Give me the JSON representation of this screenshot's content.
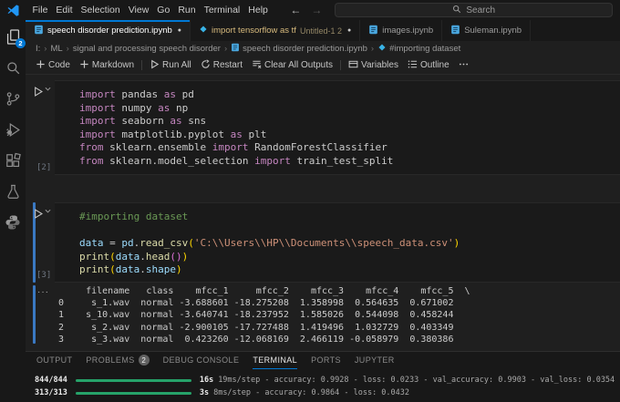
{
  "titlebar": {
    "menus": [
      "File",
      "Edit",
      "Selection",
      "View",
      "Go",
      "Run",
      "Terminal",
      "Help"
    ],
    "search_placeholder": "Search"
  },
  "activity_bar": {
    "items": [
      {
        "name": "explorer",
        "badge": "2"
      },
      {
        "name": "search"
      },
      {
        "name": "source-control"
      },
      {
        "name": "run-debug"
      },
      {
        "name": "extensions"
      },
      {
        "name": "testing"
      },
      {
        "name": "python"
      }
    ]
  },
  "tabs": [
    {
      "label": "speech disorder prediction.ipynb",
      "icon": "notebook",
      "modified": true,
      "active": true
    },
    {
      "label": "import tensorflow as tf",
      "description": "Untitled-1 2",
      "icon": "diamond",
      "modified": true,
      "active": false,
      "highlight": true
    },
    {
      "label": "images.ipynb",
      "icon": "notebook",
      "modified": false,
      "active": false
    },
    {
      "label": "Suleman.ipynb",
      "icon": "notebook",
      "modified": false,
      "active": false
    }
  ],
  "breadcrumb": {
    "items": [
      {
        "label": "I:"
      },
      {
        "label": "ML"
      },
      {
        "label": "signal and processing speech disorder"
      },
      {
        "label": "speech disorder prediction.ipynb",
        "icon": "notebook"
      },
      {
        "label": "#importing dataset",
        "icon": "diamond"
      }
    ]
  },
  "notebook_toolbar": {
    "items": [
      {
        "type": "btn",
        "icon": "add",
        "label": "Code"
      },
      {
        "type": "btn",
        "icon": "add",
        "label": "Markdown"
      },
      {
        "type": "sep"
      },
      {
        "type": "btn",
        "icon": "run",
        "label": "Run All"
      },
      {
        "type": "btn",
        "icon": "restart",
        "label": "Restart"
      },
      {
        "type": "btn",
        "icon": "clear",
        "label": "Clear All Outputs"
      },
      {
        "type": "sep"
      },
      {
        "type": "btn",
        "icon": "variables",
        "label": "Variables"
      },
      {
        "type": "btn",
        "icon": "outline",
        "label": "Outline"
      },
      {
        "type": "btn",
        "icon": "more",
        "label": ""
      }
    ]
  },
  "cells": [
    {
      "execution_count": "[2]",
      "lines": [
        [
          [
            "kw",
            "import"
          ],
          [
            "pl",
            " pandas "
          ],
          [
            "kw",
            "as"
          ],
          [
            "pl",
            " pd"
          ]
        ],
        [
          [
            "kw",
            "import"
          ],
          [
            "pl",
            " numpy "
          ],
          [
            "kw",
            "as"
          ],
          [
            "pl",
            " np"
          ]
        ],
        [
          [
            "kw",
            "import"
          ],
          [
            "pl",
            " seaborn "
          ],
          [
            "kw",
            "as"
          ],
          [
            "pl",
            " sns"
          ]
        ],
        [
          [
            "kw",
            "import"
          ],
          [
            "pl",
            " matplotlib.pyplot "
          ],
          [
            "kw",
            "as"
          ],
          [
            "pl",
            " plt"
          ]
        ],
        [
          [
            "kw",
            "from"
          ],
          [
            "pl",
            " sklearn.ensemble "
          ],
          [
            "kw",
            "import"
          ],
          [
            "pl",
            " RandomForestClassifier"
          ]
        ],
        [
          [
            "kw",
            "from"
          ],
          [
            "pl",
            " sklearn.model_selection "
          ],
          [
            "kw",
            "import"
          ],
          [
            "pl",
            " train_test_split"
          ]
        ]
      ]
    },
    {
      "execution_count": "[3]",
      "lines": [
        [
          [
            "cm",
            "#importing dataset"
          ]
        ],
        [],
        [
          [
            "var",
            "data"
          ],
          [
            "pl",
            " = "
          ],
          [
            "var",
            "pd"
          ],
          [
            "pl",
            "."
          ],
          [
            "fn",
            "read_csv"
          ],
          [
            "br1",
            "("
          ],
          [
            "str",
            "'C:\\\\Users\\\\HP\\\\Documents\\\\speech_data.csv'"
          ],
          [
            "br1",
            ")"
          ]
        ],
        [
          [
            "fn",
            "print"
          ],
          [
            "br1",
            "("
          ],
          [
            "var",
            "data"
          ],
          [
            "pl",
            "."
          ],
          [
            "fn",
            "head"
          ],
          [
            "br2",
            "("
          ],
          [
            "br2",
            ")"
          ],
          [
            "br1",
            ")"
          ]
        ],
        [
          [
            "fn",
            "print"
          ],
          [
            "br1",
            "("
          ],
          [
            "var",
            "data"
          ],
          [
            "pl",
            "."
          ],
          [
            "var",
            "shape"
          ],
          [
            "br1",
            ")"
          ]
        ]
      ]
    }
  ],
  "output_table": {
    "collapse_indicator": "···",
    "columns": [
      "",
      "filename",
      "class",
      "mfcc_1",
      "mfcc_2",
      "mfcc_3",
      "mfcc_4",
      "mfcc_5"
    ],
    "rows": [
      [
        "0",
        "s_1.wav",
        "normal",
        "-3.688601",
        "-18.275208",
        "1.358998",
        "0.564635",
        "0.671002"
      ],
      [
        "1",
        "s_10.wav",
        "normal",
        "-3.640741",
        "-18.237952",
        "1.585026",
        "0.544098",
        "0.458244"
      ],
      [
        "2",
        "s_2.wav",
        "normal",
        "-2.900105",
        "-17.727488",
        "1.419496",
        "1.032729",
        "0.403349"
      ],
      [
        "3",
        "s_3.wav",
        "normal",
        "0.423260",
        "-12.068169",
        "2.466119",
        "-0.058979",
        "0.380386"
      ]
    ],
    "lines": [
      "     filename   class    mfcc_1     mfcc_2    mfcc_3    mfcc_4    mfcc_5  \\",
      "0     s_1.wav  normal -3.688601 -18.275208  1.358998  0.564635  0.671002",
      "1    s_10.wav  normal -3.640741 -18.237952  1.585026  0.544098  0.458244",
      "2     s_2.wav  normal -2.900105 -17.727488  1.419496  1.032729  0.403349",
      "3     s_3.wav  normal  0.423260 -12.068169  2.466119 -0.058979  0.380386"
    ]
  },
  "panel": {
    "tabs": [
      {
        "label": "OUTPUT"
      },
      {
        "label": "PROBLEMS",
        "badge": "2"
      },
      {
        "label": "DEBUG CONSOLE"
      },
      {
        "label": "TERMINAL",
        "active": true
      },
      {
        "label": "PORTS"
      },
      {
        "label": "JUPYTER"
      }
    ],
    "terminal_lines": [
      {
        "progress": "844/844",
        "time": "16s",
        "metrics": "19ms/step - accuracy: 0.9928 - loss: 0.0233 - val_accuracy: 0.9903 - val_loss: 0.0354"
      },
      {
        "progress": "313/313",
        "time": "3s",
        "metrics": "8ms/step - accuracy: 0.9864 - loss: 0.0432"
      }
    ]
  },
  "colors": {
    "accent_blue": "#0078d4",
    "progress_green": "#26a269",
    "modified_tab_label": "#d7ba7d",
    "modified_tab_desc": "#948766",
    "badge_blue": "#0078d4",
    "syntax": {
      "keyword": "#c586c0",
      "comment": "#6a9955",
      "string": "#ce9178",
      "function": "#dcdcaa",
      "variable": "#9cdcfe",
      "bracket1": "#ffd700",
      "bracket2": "#da70d6"
    }
  }
}
